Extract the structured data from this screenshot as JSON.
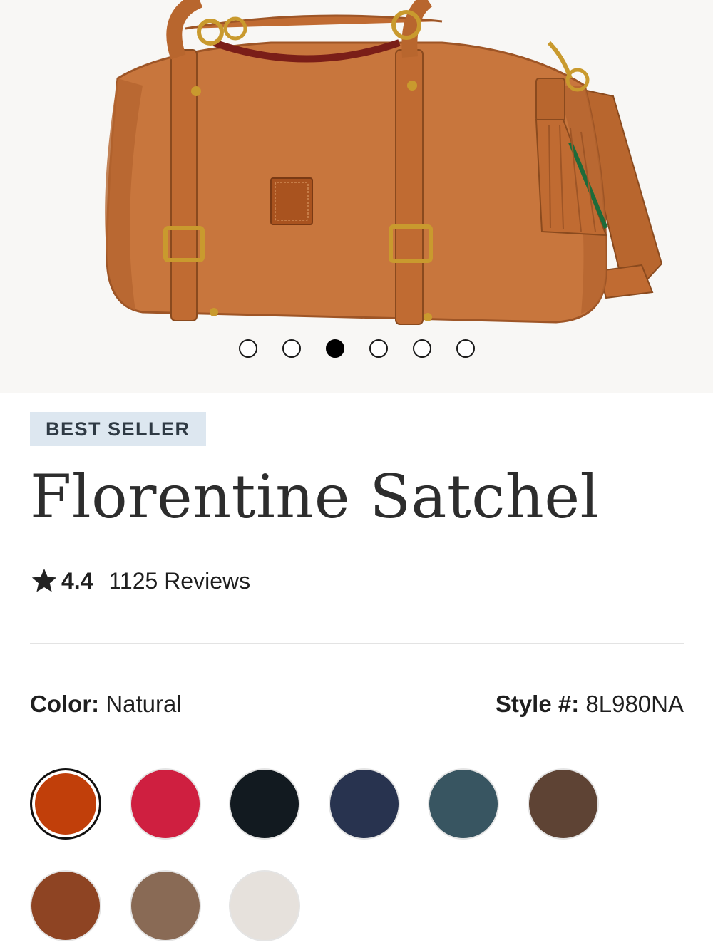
{
  "gallery": {
    "image_alt": "Florentine Satchel product photo",
    "dots": [
      {
        "label": "Image 1",
        "active": false
      },
      {
        "label": "Image 2",
        "active": false
      },
      {
        "label": "Image 3",
        "active": true
      },
      {
        "label": "Image 4",
        "active": false
      },
      {
        "label": "Image 5",
        "active": false
      },
      {
        "label": "Image 6",
        "active": false
      }
    ]
  },
  "product": {
    "badge": "BEST SELLER",
    "title": "Florentine Satchel",
    "rating": "4.4",
    "reviews": "1125 Reviews",
    "color_label": "Color:",
    "color_value": "Natural",
    "style_label": "Style #:",
    "style_value": "8L980NA"
  },
  "swatches": [
    {
      "name": "natural-swatch",
      "color": "#c13f0a",
      "selected": true
    },
    {
      "name": "red-swatch",
      "color": "#cf1f40",
      "selected": false
    },
    {
      "name": "black-swatch",
      "color": "#121a20",
      "selected": false
    },
    {
      "name": "navy-swatch",
      "color": "#28334f",
      "selected": false
    },
    {
      "name": "teal-swatch",
      "color": "#385561",
      "selected": false
    },
    {
      "name": "brown-swatch",
      "color": "#5e4334",
      "selected": false
    },
    {
      "name": "chestnut-swatch",
      "color": "#8e4423",
      "selected": false
    },
    {
      "name": "taupe-swatch",
      "color": "#896a55",
      "selected": false
    },
    {
      "name": "bone-swatch",
      "color": "#e6e1dc",
      "selected": false
    }
  ],
  "colors": {
    "leather": "#c8763d",
    "leather_dark": "#9e5526",
    "hardware": "#c99a2e",
    "badge_bg": "#dde7f0"
  }
}
